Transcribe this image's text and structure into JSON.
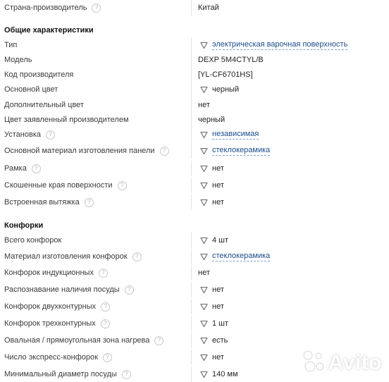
{
  "rows": [
    {
      "name": "Страна-производитель",
      "help": true,
      "value": "Китай",
      "filter": false,
      "link": false
    },
    {
      "name": "Тип",
      "help": false,
      "value": "электрическая варочная поверхность",
      "filter": true,
      "link": true
    },
    {
      "name": "Модель",
      "help": false,
      "value": "DEXP 5M4CTYL/B",
      "filter": false,
      "link": false
    },
    {
      "name": "Код производителя",
      "help": false,
      "value": "[YL-CF6701HS]",
      "filter": false,
      "link": false
    },
    {
      "name": "Основной цвет",
      "help": false,
      "value": "черный",
      "filter": true,
      "link": false
    },
    {
      "name": "Дополнительный цвет",
      "help": false,
      "value": "нет",
      "filter": false,
      "link": false
    },
    {
      "name": "Цвет заявленный производителем",
      "help": false,
      "value": "черный",
      "filter": false,
      "link": false
    },
    {
      "name": "Установка",
      "help": true,
      "value": "независимая",
      "filter": true,
      "link": true
    },
    {
      "name": "Основной материал изготовления панели",
      "help": true,
      "value": "стеклокерамика",
      "filter": true,
      "link": true
    },
    {
      "name": "Рамка",
      "help": true,
      "value": "нет",
      "filter": true,
      "link": false
    },
    {
      "name": "Скошенные края поверхности",
      "help": true,
      "value": "нет",
      "filter": true,
      "link": false
    },
    {
      "name": "Встроенная вытяжка",
      "help": true,
      "value": "нет",
      "filter": true,
      "link": false
    },
    {
      "name": "Всего конфорок",
      "help": false,
      "value": "4 шт",
      "filter": true,
      "link": false
    },
    {
      "name": "Материал изготовления конфорок",
      "help": true,
      "value": "стеклокерамика",
      "filter": true,
      "link": true
    },
    {
      "name": "Конфорок индукционных",
      "help": true,
      "value": "нет",
      "filter": false,
      "link": false
    },
    {
      "name": "Распознавание наличия посуды",
      "help": true,
      "value": "нет",
      "filter": true,
      "link": false
    },
    {
      "name": "Конфорок двухконтурных",
      "help": true,
      "value": "нет",
      "filter": true,
      "link": false
    },
    {
      "name": "Конфорок трехконтурных",
      "help": true,
      "value": "1 шт",
      "filter": true,
      "link": false
    },
    {
      "name": "Овальная / прямоугольная зона нагрева",
      "help": true,
      "value": "есть",
      "filter": true,
      "link": false
    },
    {
      "name": "Число экспресс-конфорок",
      "help": true,
      "value": "нет",
      "filter": true,
      "link": false
    },
    {
      "name": "Минимальный диаметр посуды",
      "help": true,
      "value": "140 мм",
      "filter": true,
      "link": false
    }
  ],
  "sections": {
    "general": "Общие характеристики",
    "burners": "Конфорки"
  },
  "watermark": {
    "text": "Avito"
  }
}
